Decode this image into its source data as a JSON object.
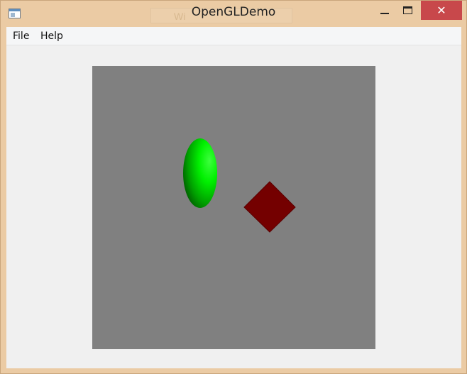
{
  "window": {
    "title": "OpenGLDemo",
    "ghost_tab_text": "Wi",
    "close_glyph": "✕"
  },
  "menubar": {
    "items": [
      {
        "label": "File"
      },
      {
        "label": "Help"
      }
    ]
  },
  "viewport": {
    "background_color": "#808080",
    "objects": [
      {
        "name": "green-ellipsoid",
        "color": "#00ff00"
      },
      {
        "name": "red-diamond",
        "color": "#7a0000"
      }
    ]
  },
  "colors": {
    "frame": "#ebcba4",
    "close_button": "#c8484b",
    "client_bg": "#f0f0f0"
  },
  "icons": [
    "app-window-icon",
    "minimize-icon",
    "maximize-icon",
    "close-icon"
  ]
}
